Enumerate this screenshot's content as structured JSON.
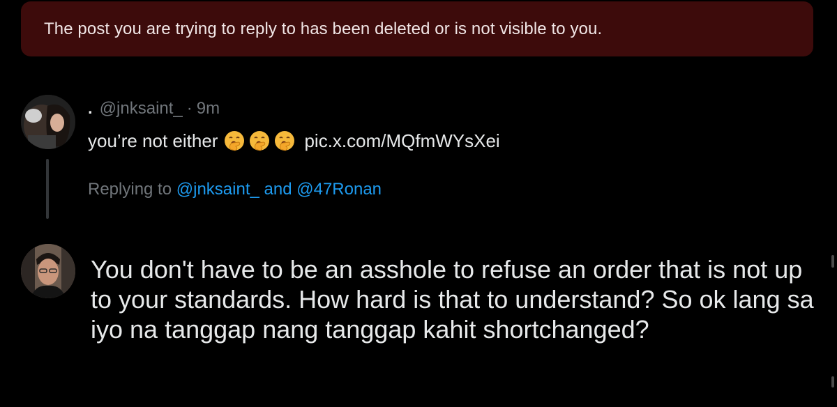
{
  "banner": {
    "text": "The post you are trying to reply to has been deleted or is not visible to you."
  },
  "parent_post": {
    "display_name": ".",
    "handle": "@jnksaint_",
    "separator": "·",
    "time": "9m",
    "text": "you’re not either",
    "emojis": [
      "yawning-face",
      "yawning-face",
      "yawning-face"
    ],
    "link": "pic.x.com/MQfmWYsXei"
  },
  "replying": {
    "prefix": "Replying to",
    "mention1": "@jnksaint_",
    "conjunction": "and",
    "mention2": "@47Ronan"
  },
  "composer": {
    "text": "You don't have to be an asshole to refuse an order that is not up to your standards. How hard is that to understand? So ok lang sa iyo na tanggap nang tanggap kahit shortchanged?"
  },
  "colors": {
    "banner_bg": "#3d0b0b",
    "link_blue": "#1d9bf0",
    "muted": "#71767b",
    "text": "#e7e9ea"
  }
}
